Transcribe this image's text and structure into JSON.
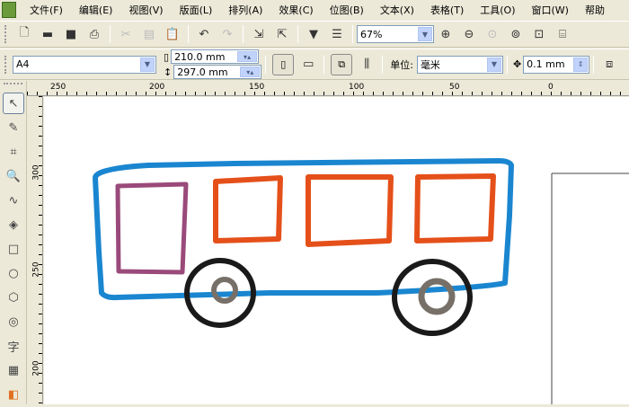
{
  "menu": [
    "文件(F)",
    "编辑(E)",
    "视图(V)",
    "版面(L)",
    "排列(A)",
    "效果(C)",
    "位图(B)",
    "文本(X)",
    "表格(T)",
    "工具(O)",
    "窗口(W)",
    "帮助"
  ],
  "toolbar": {
    "zoom": "67%"
  },
  "property_bar": {
    "page_size": "A4",
    "width": "210.0 mm",
    "height": "297.0 mm",
    "unit_label": "单位:",
    "unit": "毫米",
    "nudge": "0.1 mm"
  },
  "ruler_top": [
    "250",
    "200",
    "150",
    "100",
    "50",
    "0"
  ],
  "ruler_left": [
    "300",
    "250",
    "200"
  ],
  "toolbox": {
    "text_tool": "字"
  },
  "colors": {
    "bus_body": "#1a86d0",
    "window_purple": "#9a4a7a",
    "window_orange": "#e5501a",
    "wheel": "#1a1a1a",
    "hub": "#777068"
  }
}
